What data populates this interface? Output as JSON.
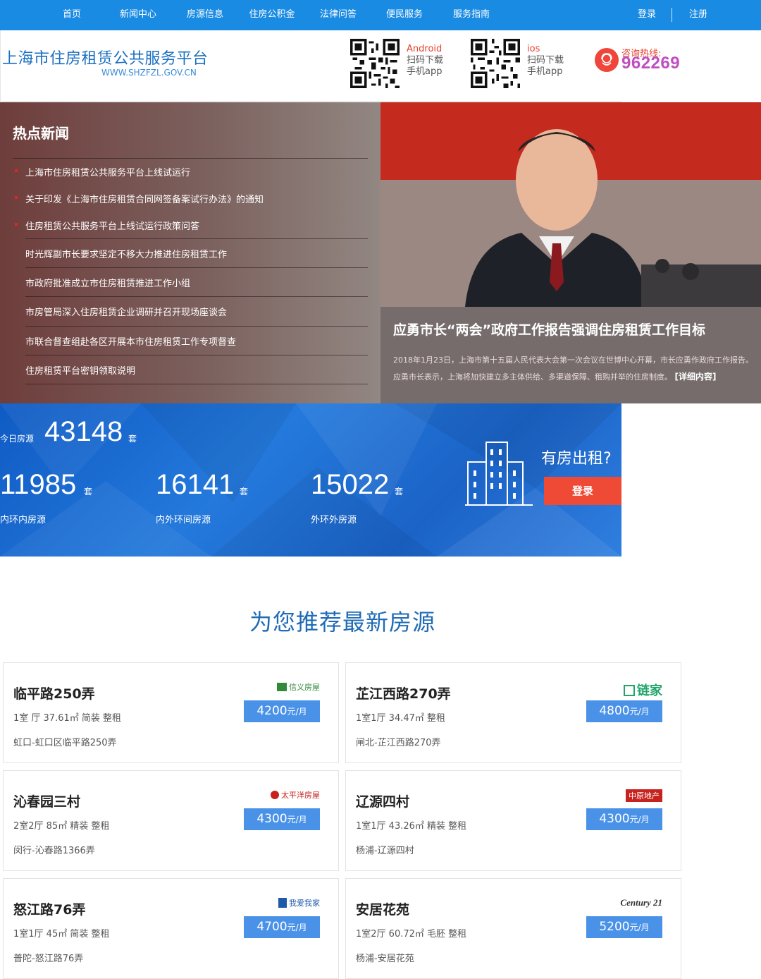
{
  "nav": {
    "items": [
      "首页",
      "新闻中心",
      "房源信息",
      "住房公积金",
      "法律问答",
      "便民服务",
      "服务指南"
    ],
    "login": "登录",
    "register": "注册"
  },
  "header": {
    "title": "上海市住房租赁公共服务平台",
    "url": "WWW.SHZFZL.GOV.CN",
    "android": {
      "os": "Android",
      "line1": "扫码下载",
      "line2": "手机app"
    },
    "ios": {
      "os": "ios",
      "line1": "扫码下载",
      "line2": "手机app"
    },
    "hotline_label": "咨询热线:",
    "hotline_number": "962269"
  },
  "news": {
    "heading": "热点新闻",
    "items": [
      "上海市住房租赁公共服务平台上线试运行",
      "关于印发《上海市住房租赁合同网签备案试行办法》的通知",
      "住房租赁公共服务平台上线试运行政策问答",
      "时光辉副市长要求坚定不移大力推进住房租赁工作",
      "市政府批准成立市住房租赁推进工作小组",
      "市房管局深入住房租赁企业调研并召开现场座谈会",
      "市联合督查组赴各区开展本市住房租赁工作专项督查",
      "住房租赁平台密钥领取说明"
    ],
    "feature_title": "应勇市长“两会”政府工作报告强调住房租赁工作目标",
    "feature_line1": "2018年1月23日，上海市第十五届人民代表大会第一次会议在世博中心开幕，市长应勇作政府工作报告。",
    "feature_line2": "应勇市长表示，上海将加快建立多主体供给、多渠道保障、租购并举的住房制度。",
    "feature_more": "[详细内容]"
  },
  "stats": {
    "today_label": "今日房源",
    "today_value": "43148",
    "unit": "套",
    "inner_value": "11985",
    "inner_label": "内环内房源",
    "middle_value": "16141",
    "middle_label": "内外环间房源",
    "outer_value": "15022",
    "outer_label": "外环外房源",
    "rent_question": "有房出租?",
    "login_button": "登录"
  },
  "recommend": {
    "title": "为您推荐最新房源",
    "price_unit": "元/月",
    "listings": [
      {
        "name": "临平路250弄",
        "spec": "1室 厅 37.61㎡ 简装 整租",
        "addr": "虹口-虹口区临平路250弄",
        "price": "4200",
        "brand": "信义房屋",
        "brand_color": "#2f8a3b"
      },
      {
        "name": "芷江西路270弄",
        "spec": "1室1厅 34.47㎡  整租",
        "addr": "闸北-芷江西路270弄",
        "price": "4800",
        "brand": "链家",
        "brand_color": "#20a56a"
      },
      {
        "name": "沁春园三村",
        "spec": "2室2厅 85㎡ 精装 整租",
        "addr": "闵行-沁春路1366弄",
        "price": "4300",
        "brand": "太平洋房屋",
        "brand_color": "#c7221d"
      },
      {
        "name": "辽源四村",
        "spec": "1室1厅 43.26㎡ 精装 整租",
        "addr": "杨浦-辽源四村",
        "price": "4300",
        "brand": "中原地产",
        "brand_color": "#c7221d"
      },
      {
        "name": "怒江路76弄",
        "spec": "1室1厅 45㎡ 简装 整租",
        "addr": "普陀-怒江路76弄",
        "price": "4700",
        "brand": "我爱我家",
        "brand_color": "#1f5aa8"
      },
      {
        "name": "安居花苑",
        "spec": "1室2厅 60.72㎡ 毛胚 整租",
        "addr": "杨浦-安居花苑",
        "price": "5200",
        "brand": "Century 21",
        "brand_color": "#333333"
      }
    ]
  }
}
